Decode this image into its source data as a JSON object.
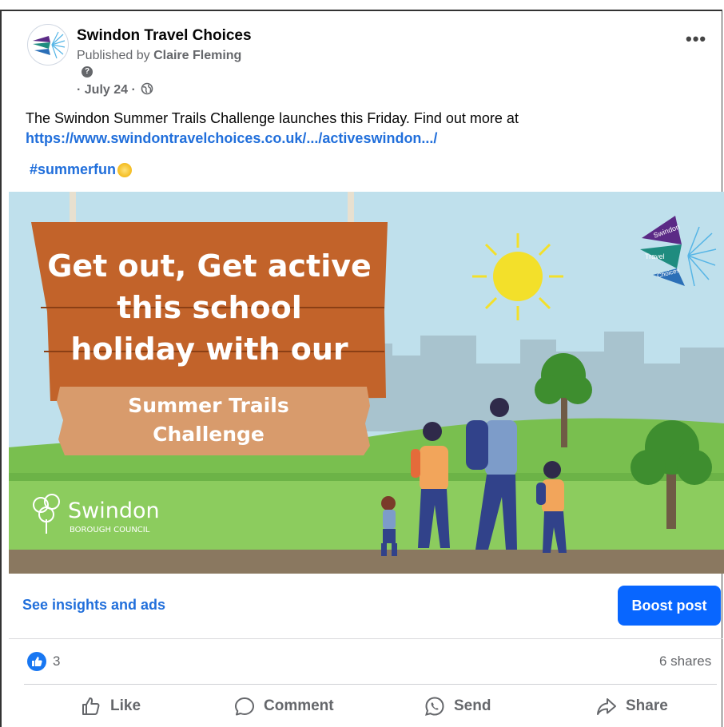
{
  "post": {
    "page_name": "Swindon Travel Choices",
    "published_prefix": "Published by ",
    "published_author": "Claire Fleming",
    "date": "· July 24 ·",
    "more_label": "•••",
    "text": "The Swindon Summer Trails Challenge launches this Friday.  Find out more at",
    "link": "https://www.swindontravelchoices.co.uk/.../activeswindon.../",
    "hashtag": "#summerfun",
    "hashtag_emoji": "sun-emoji"
  },
  "image": {
    "sign_line1": "Get out, Get active",
    "sign_line2": "this school",
    "sign_line3": "holiday with our",
    "plank_line1": "Summer Trails",
    "plank_line2": "Challenge",
    "logo_word1": "Swindon",
    "logo_word2": "Travel",
    "logo_word3": "Choices",
    "council_name": "Swindon",
    "council_sub": "BOROUGH COUNCIL"
  },
  "footer": {
    "insights": "See insights and ads",
    "boost": "Boost post",
    "like_count": "3",
    "shares": "6 shares"
  },
  "actions": {
    "like": "Like",
    "comment": "Comment",
    "send": "Send",
    "share": "Share"
  },
  "colors": {
    "accent_blue": "#0866ff",
    "link_blue": "#216fdb",
    "sky": "#bfe0ec",
    "grass": "#8ccc5e",
    "wood": "#c2632a"
  }
}
